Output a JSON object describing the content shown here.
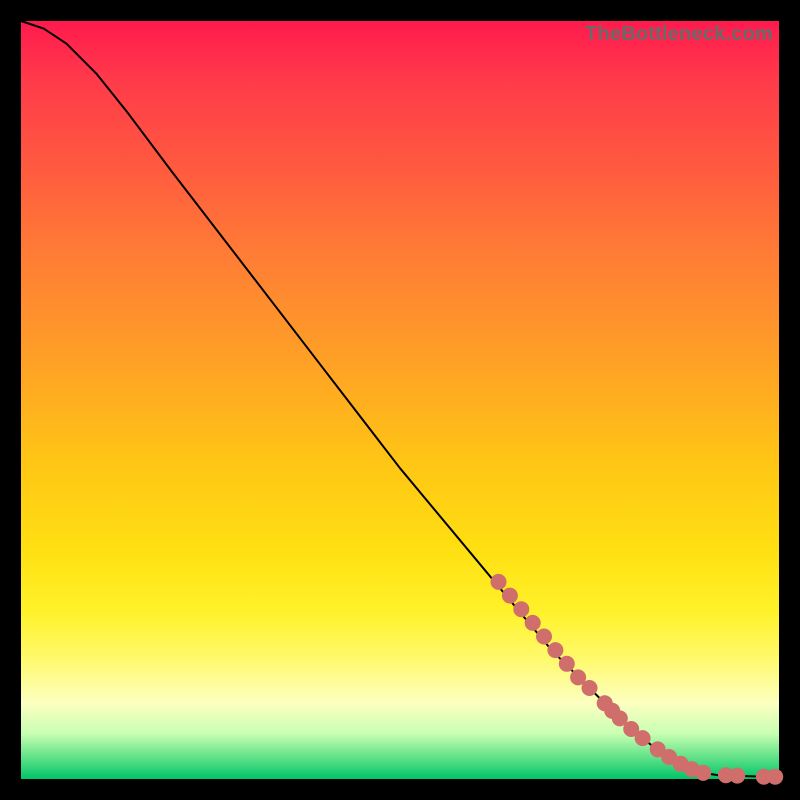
{
  "watermark": "TheBottleneck.com",
  "chart_data": {
    "type": "line",
    "title": "",
    "xlabel": "",
    "ylabel": "",
    "xlim": [
      0,
      100
    ],
    "ylim": [
      0,
      100
    ],
    "curve": [
      {
        "x": 0,
        "y": 100
      },
      {
        "x": 3,
        "y": 99
      },
      {
        "x": 6,
        "y": 97
      },
      {
        "x": 10,
        "y": 93
      },
      {
        "x": 14,
        "y": 88
      },
      {
        "x": 20,
        "y": 80
      },
      {
        "x": 30,
        "y": 67
      },
      {
        "x": 40,
        "y": 54
      },
      {
        "x": 50,
        "y": 41
      },
      {
        "x": 60,
        "y": 29
      },
      {
        "x": 65,
        "y": 23
      },
      {
        "x": 70,
        "y": 17
      },
      {
        "x": 75,
        "y": 12
      },
      {
        "x": 80,
        "y": 7
      },
      {
        "x": 85,
        "y": 3
      },
      {
        "x": 88,
        "y": 1.4
      },
      {
        "x": 90,
        "y": 0.8
      },
      {
        "x": 92,
        "y": 0.5
      },
      {
        "x": 95,
        "y": 0.4
      },
      {
        "x": 98,
        "y": 0.3
      },
      {
        "x": 100,
        "y": 0.3
      }
    ],
    "markers": [
      {
        "x": 63,
        "y": 26
      },
      {
        "x": 64.5,
        "y": 24.2
      },
      {
        "x": 66,
        "y": 22.4
      },
      {
        "x": 67.5,
        "y": 20.6
      },
      {
        "x": 69,
        "y": 18.8
      },
      {
        "x": 70.5,
        "y": 17.0
      },
      {
        "x": 72,
        "y": 15.2
      },
      {
        "x": 73.5,
        "y": 13.4
      },
      {
        "x": 75,
        "y": 12.0
      },
      {
        "x": 77,
        "y": 10.0
      },
      {
        "x": 78,
        "y": 9.0
      },
      {
        "x": 79,
        "y": 8.0
      },
      {
        "x": 80.5,
        "y": 6.6
      },
      {
        "x": 82,
        "y": 5.4
      },
      {
        "x": 84,
        "y": 3.9
      },
      {
        "x": 85.5,
        "y": 2.9
      },
      {
        "x": 87,
        "y": 2.0
      },
      {
        "x": 88.5,
        "y": 1.3
      },
      {
        "x": 90,
        "y": 0.8
      },
      {
        "x": 93,
        "y": 0.5
      },
      {
        "x": 94.5,
        "y": 0.45
      },
      {
        "x": 98,
        "y": 0.3
      },
      {
        "x": 99.5,
        "y": 0.3
      }
    ]
  }
}
